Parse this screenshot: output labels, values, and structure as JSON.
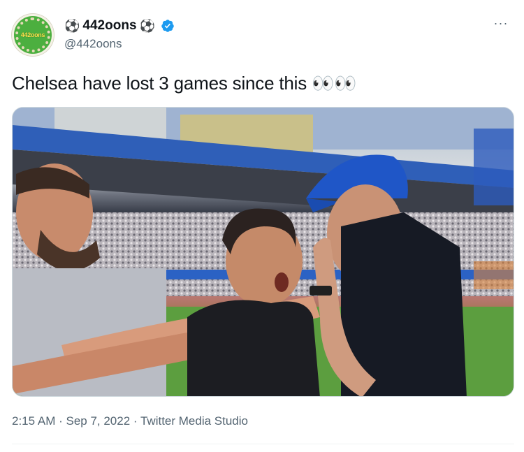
{
  "author": {
    "display_name": "442oons",
    "name_prefix_emoji": "⚽",
    "name_suffix_emoji": "⚽",
    "handle": "@442oons",
    "verified": true,
    "avatar_text": "442oons"
  },
  "more_label": "···",
  "tweet": {
    "text": "Chelsea have lost 3 games since this 👀👀"
  },
  "meta": {
    "timestamp": "2:15 AM · Sep 7, 2022 · Twitter Media Studio"
  },
  "colors": {
    "verified": "#1d9bf0",
    "secondary_text": "#536471",
    "primary_text": "#0f1419"
  },
  "icons": {
    "verified": "verified-badge-icon",
    "more": "more-horizontal-icon"
  }
}
